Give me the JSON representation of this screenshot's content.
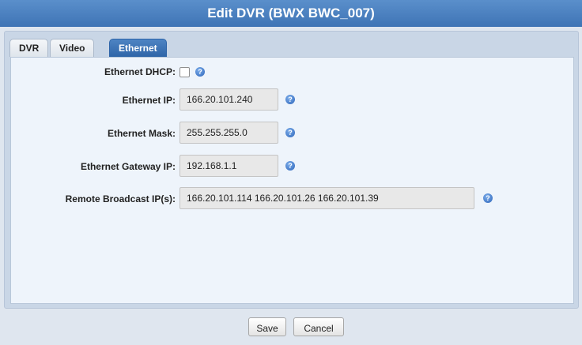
{
  "dialog": {
    "title": "Edit DVR (BWX BWC_007)"
  },
  "tabs": [
    {
      "label": "DVR",
      "active": false
    },
    {
      "label": "Video",
      "active": false
    },
    {
      "label": "Ethernet",
      "active": true
    }
  ],
  "fields": {
    "dhcp": {
      "label": "Ethernet DHCP:",
      "checked": false
    },
    "ip": {
      "label": "Ethernet IP:",
      "value": "166.20.101.240"
    },
    "mask": {
      "label": "Ethernet Mask:",
      "value": "255.255.255.0"
    },
    "gateway": {
      "label": "Ethernet Gateway IP:",
      "value": "192.168.1.1"
    },
    "broadcast": {
      "label": "Remote Broadcast IP(s):",
      "value": "166.20.101.114 166.20.101.26 166.20.101.39"
    }
  },
  "help_icon": "help-icon",
  "buttons": {
    "save": "Save",
    "cancel": "Cancel"
  },
  "colors": {
    "titlebar": "#3f74b5",
    "active_tab": "#2f65a8",
    "help": "#2a62b8"
  }
}
